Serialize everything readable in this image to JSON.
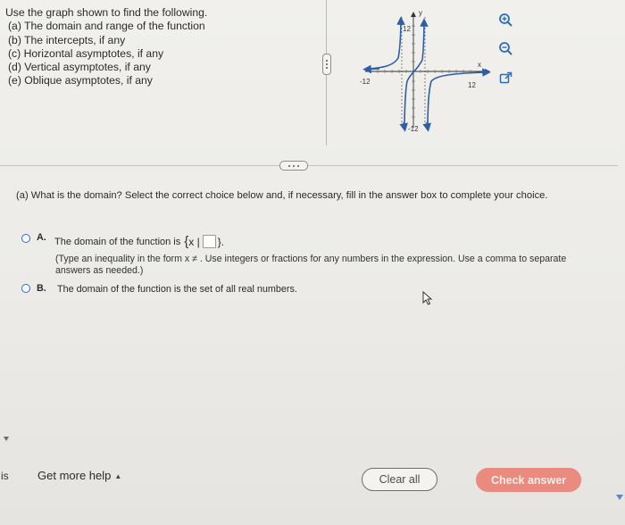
{
  "problem": {
    "intro": "Use the graph shown to find the following.",
    "parts": [
      "(a) The domain and range of the function",
      "(b) The intercepts, if any",
      "(c) Horizontal asymptotes, if any",
      "(d) Vertical asymptotes, if any",
      "(e) Oblique asymptotes, if any"
    ]
  },
  "graph": {
    "y_label": "y",
    "x_label": "x",
    "y_top_tick": "12",
    "y_bottom_tick": "-12",
    "x_left_tick": "-12",
    "x_right_tick": "12"
  },
  "tools": {
    "icons": [
      "zoom-in-icon",
      "zoom-out-icon",
      "external-link-icon"
    ],
    "accent": "#2d6dbd"
  },
  "question": {
    "text": "(a) What is the domain? Select the correct choice below and, if necessary, fill in the answer box to complete your choice."
  },
  "options": {
    "a": {
      "letter": "A.",
      "prefix": "The domain of the function is",
      "set_open": "{",
      "set_var": "x |",
      "set_close": "}.",
      "answer_value": "",
      "hint": "(Type an inequality in the form x ≠ . Use integers or fractions for any numbers in the expression. Use a comma to separate answers as needed.)"
    },
    "b": {
      "letter": "B.",
      "text": "The domain of the function is the set of all real numbers."
    }
  },
  "footer": {
    "left_fragment": "is",
    "help_label": "Get more help",
    "help_caret": "▲",
    "clear_label": "Clear all",
    "check_label": "Check answer",
    "check_color": "#e98b7e"
  }
}
